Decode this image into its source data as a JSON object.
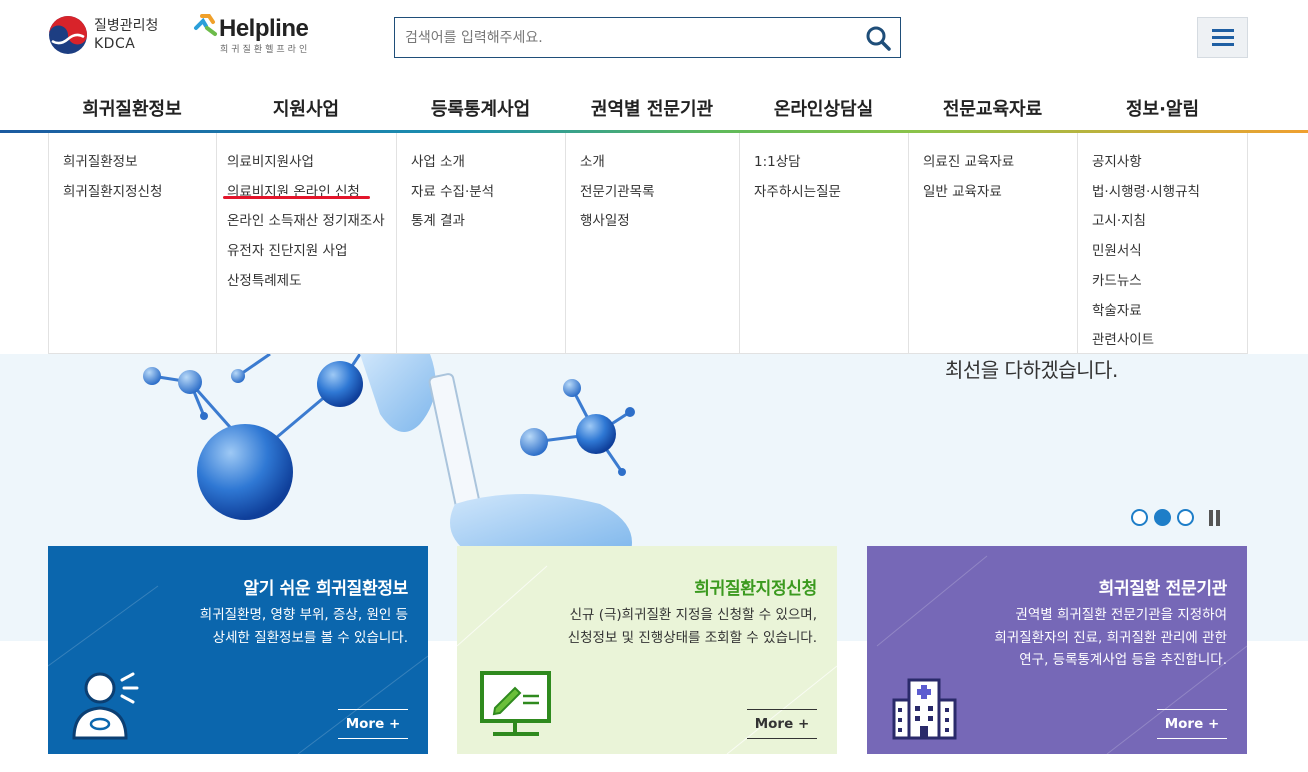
{
  "header": {
    "kdca_name_ko": "질병관리청",
    "kdca_name_en": "KDCA",
    "helpline_word": "Helpline",
    "helpline_sub": "희귀질환헬프라인",
    "search_placeholder": "검색어를 입력해주세요.",
    "icons": {
      "search": "search-icon",
      "menu": "hamburger-menu-icon"
    }
  },
  "gnb": [
    {
      "label": "희귀질환정보",
      "subitems": [
        "희귀질환정보",
        "희귀질환지정신청"
      ]
    },
    {
      "label": "지원사업",
      "subitems": [
        "의료비지원사업",
        "의료비지원 온라인 신청",
        "온라인 소득재산 정기재조사",
        "유전자 진단지원 사업",
        "산정특례제도"
      ]
    },
    {
      "label": "등록통계사업",
      "subitems": [
        "사업 소개",
        "자료 수집·분석",
        "통계 결과"
      ]
    },
    {
      "label": "권역별 전문기관",
      "subitems": [
        "소개",
        "전문기관목록",
        "행사일정"
      ]
    },
    {
      "label": "온라인상담실",
      "subitems": [
        "1:1상담",
        "자주하시는질문"
      ]
    },
    {
      "label": "전문교육자료",
      "subitems": [
        "의료진 교육자료",
        "일반 교육자료"
      ]
    },
    {
      "label": "정보·알림",
      "subitems": [
        "공지사항",
        "법·시행령·시행규칙",
        "고시·지침",
        "민원서식",
        "카드뉴스",
        "학술자료",
        "관련사이트"
      ]
    }
  ],
  "hero": {
    "text": "최선을 다하겠습니다.",
    "slides": 3,
    "active_slide": 2
  },
  "cards": [
    {
      "title": "알기 쉬운 희귀질환정보",
      "desc": [
        "희귀질환명, 영향 부위, 증상, 원인 등",
        "상세한 질환정보를 볼 수 있습니다."
      ],
      "more": "More +",
      "icon": "person-speaking-icon"
    },
    {
      "title": "희귀질환지정신청",
      "desc": [
        "신규 (극)희귀질환 지정을 신청할 수 있으며,",
        "신청정보 및 진행상태를 조회할 수 있습니다."
      ],
      "more": "More +",
      "icon": "monitor-pencil-icon"
    },
    {
      "title": "희귀질환 전문기관",
      "desc": [
        "권역별 희귀질환 전문기관을 지정하여",
        "희귀질환자의 진료, 희귀질환 관리에 관한",
        "연구, 등록통계사업 등을 추진합니다."
      ],
      "more": "More +",
      "icon": "hospital-icon"
    }
  ],
  "colors": {
    "brand_blue": "#0b66ad",
    "card_green_bg": "#eaf4d8",
    "card_purple": "#7668b7",
    "highlight_red": "#e3152b"
  }
}
